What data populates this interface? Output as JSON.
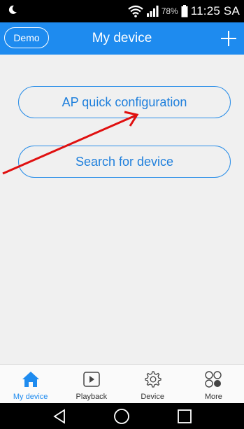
{
  "statusbar": {
    "battery_percent": "78%",
    "time": "11:25 SA"
  },
  "header": {
    "demo_label": "Demo",
    "title": "My device"
  },
  "main": {
    "ap_button": "AP quick configuration",
    "search_button": "Search for device"
  },
  "tabs": [
    {
      "label": "My device",
      "icon": "home-icon",
      "active": true
    },
    {
      "label": "Playback",
      "icon": "play-icon",
      "active": false
    },
    {
      "label": "Device",
      "icon": "gear-icon",
      "active": false
    },
    {
      "label": "More",
      "icon": "more-circles-icon",
      "active": false
    }
  ],
  "colors": {
    "accent": "#1e8bef",
    "annotation_arrow": "#e01010"
  }
}
